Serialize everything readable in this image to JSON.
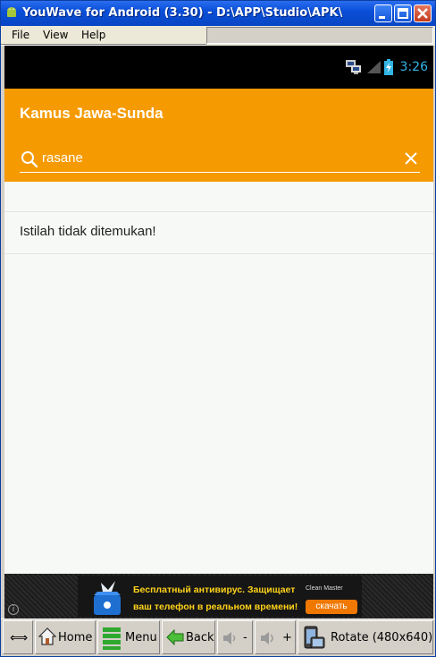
{
  "window": {
    "title": "YouWave for Android (3.30) - D:\\APP\\Studio\\APK\\"
  },
  "menu": {
    "items": [
      {
        "label": "File"
      },
      {
        "label": "View"
      },
      {
        "label": "Help"
      }
    ]
  },
  "status_bar": {
    "time": "3:26"
  },
  "app": {
    "title": "Kamus Jawa-Sunda",
    "search_query": "rasane",
    "result_message": "Istilah tidak ditemukan!"
  },
  "ad": {
    "line1": "Бесплатный антивирус. Защищает",
    "line2": "ваш телефон в реальном времени!",
    "brand": "Clean Master",
    "cta": "скачать"
  },
  "toolbar": {
    "resize_label": "⟺",
    "home_label": "Home",
    "menu_label": "Menu",
    "back_label": "Back",
    "vol_down_label": "-",
    "vol_up_label": "+",
    "rotate_label": "Rotate (480x640)"
  },
  "colors": {
    "accent": "#f59a00",
    "status_time": "#33b5e5",
    "ad_text": "#ffd31a"
  }
}
